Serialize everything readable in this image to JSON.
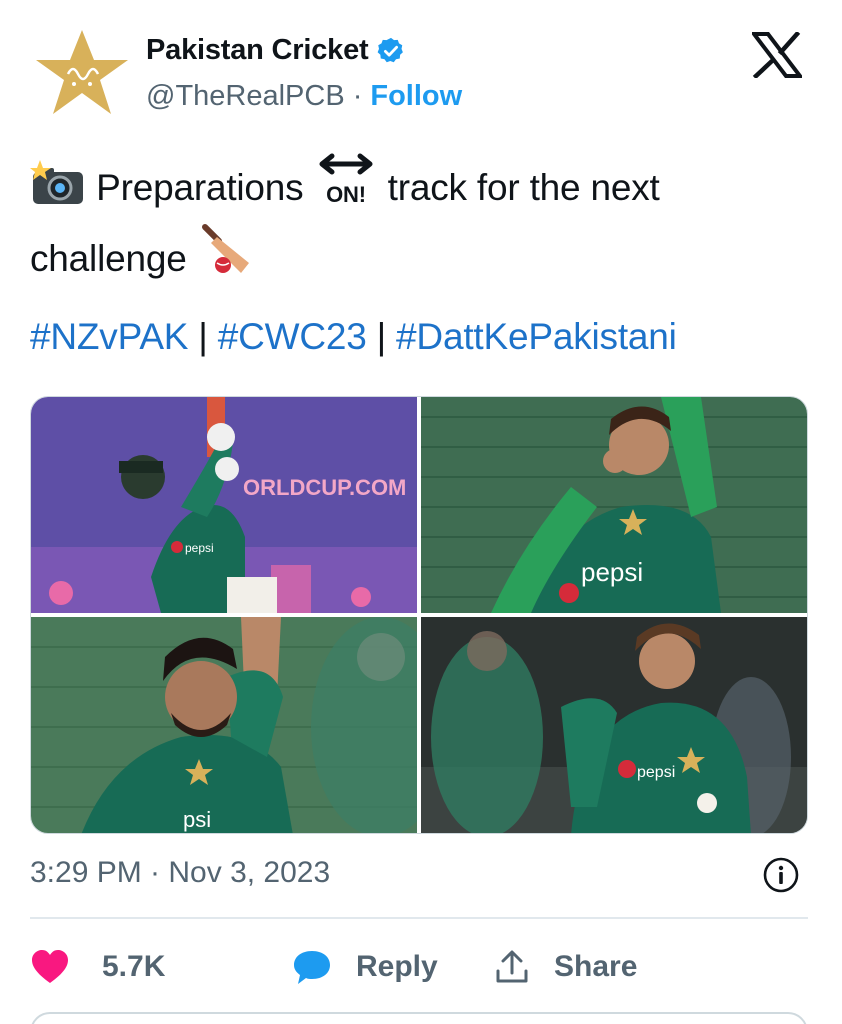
{
  "author": {
    "display_name": "Pakistan Cricket",
    "handle": "@TheRealPCB",
    "separator": "·",
    "follow_label": "Follow"
  },
  "tweet": {
    "text_part1": "Preparations",
    "text_part2": "track for the next",
    "text_part3": "challenge",
    "emoji_on_label": "ON!",
    "hashtags": [
      "#NZvPAK",
      "#CWC23",
      "#DattKePakistani"
    ],
    "hashtag_separator": "|"
  },
  "media": {
    "photos": [
      {
        "banner_text": "ORLDCUP.COM",
        "sponsor": "pepsi"
      },
      {
        "sponsor": "pepsi"
      },
      {
        "sponsor": "psi"
      },
      {
        "sponsor": "pepsi"
      }
    ]
  },
  "meta": {
    "timestamp": "3:29 PM · Nov 3, 2023"
  },
  "actions": {
    "like_count": "5.7K",
    "reply_label": "Reply",
    "share_label": "Share"
  },
  "colors": {
    "accent": "#1d9bf0",
    "like": "#f91880",
    "hashtag": "#1d72c9",
    "muted": "#536471",
    "pcb_gold": "#d8b15a",
    "kit_green": "#176b55"
  },
  "icons": [
    "pcb-star-logo",
    "verified-badge-icon",
    "x-logo-icon",
    "camera-flash-emoji",
    "on-arrow-emoji",
    "cricket-bat-emoji",
    "info-icon",
    "heart-icon",
    "reply-bubble-icon",
    "share-icon"
  ]
}
